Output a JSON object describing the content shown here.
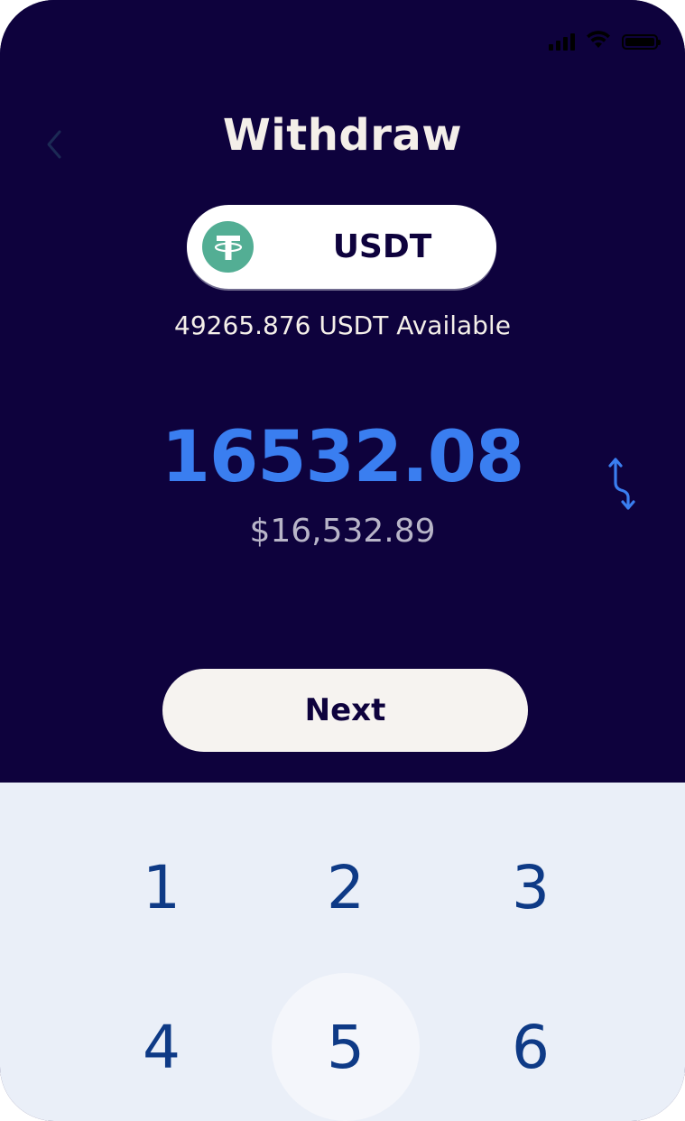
{
  "status_bar": {
    "signal_icon": "cellular-signal-icon",
    "wifi_icon": "wifi-icon",
    "battery_icon": "battery-full-icon"
  },
  "header": {
    "back_icon": "chevron-left-icon",
    "title": "Withdraw"
  },
  "asset_selector": {
    "icon": "tether-logo-icon",
    "label": "USDT"
  },
  "balance": {
    "available_text": "49265.876 USDT Available"
  },
  "amount": {
    "value": "16532.08",
    "fiat_value": "$16,532.89",
    "swap_icon": "swap-vertical-icon"
  },
  "actions": {
    "next_label": "Next"
  },
  "keypad": {
    "keys": [
      "1",
      "2",
      "3",
      "4",
      "5",
      "6"
    ],
    "pressed_key": "5"
  },
  "colors": {
    "background": "#0e023d",
    "accent": "#3a7ef0",
    "tether_green": "#53ae94",
    "keypad_background": "#eaeff8",
    "key_text": "#0e3a86"
  }
}
